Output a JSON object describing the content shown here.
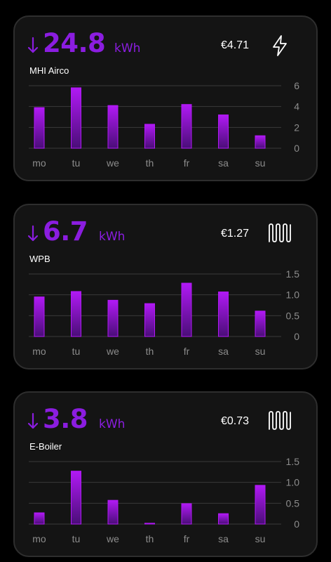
{
  "cards": [
    {
      "consumption": "24.8",
      "unit": "kWh",
      "device": "MHI Airco",
      "cost": "€4.71",
      "icon": "lightning-icon",
      "chart_data": {
        "type": "bar",
        "categories": [
          "mo",
          "tu",
          "we",
          "th",
          "fr",
          "sa",
          "su"
        ],
        "values": [
          3.9,
          5.8,
          4.1,
          2.3,
          4.2,
          3.2,
          1.2
        ],
        "ylim": [
          0,
          6
        ],
        "yticks": [
          "0",
          "2",
          "4",
          "6"
        ],
        "grid": true
      }
    },
    {
      "consumption": "6.7",
      "unit": "kWh",
      "device": "WPB",
      "cost": "€1.27",
      "icon": "heating-coil-icon",
      "chart_data": {
        "type": "bar",
        "categories": [
          "mo",
          "tu",
          "we",
          "th",
          "fr",
          "sa",
          "su"
        ],
        "values": [
          0.95,
          1.08,
          0.87,
          0.79,
          1.28,
          1.07,
          0.61
        ],
        "ylim": [
          0,
          1.5
        ],
        "yticks": [
          "0",
          "0.5",
          "1.0",
          "1.5"
        ],
        "grid": true
      }
    },
    {
      "consumption": "3.8",
      "unit": "kWh",
      "device": "E-Boiler",
      "cost": "€0.73",
      "icon": "heating-coil-icon",
      "chart_data": {
        "type": "bar",
        "categories": [
          "mo",
          "tu",
          "we",
          "th",
          "fr",
          "sa",
          "su"
        ],
        "values": [
          0.27,
          1.27,
          0.57,
          0.02,
          0.49,
          0.25,
          0.93
        ],
        "ylim": [
          0,
          1.5
        ],
        "yticks": [
          "0",
          "0.5",
          "1.0",
          "1.5"
        ],
        "grid": true
      }
    }
  ],
  "colors": {
    "accent": "#8b1de0",
    "bar_top": "#b119f5",
    "bar_bottom": "#4a0e78",
    "card_bg": "#141414",
    "card_border": "#2e2e2e",
    "grid": "#3a3a3a",
    "label": "#8c8c8c"
  }
}
